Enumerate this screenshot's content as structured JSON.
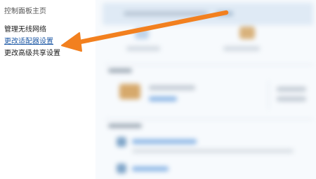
{
  "sidebar": {
    "home_label": "控制面板主页",
    "links": [
      {
        "label": "管理无线网络",
        "highlighted": false
      },
      {
        "label": "更改适配器设置",
        "highlighted": true
      },
      {
        "label": "更改高级共享设置",
        "highlighted": false
      }
    ]
  },
  "colors": {
    "link_highlight": "#1f5aa6",
    "arrow": "#f2801f"
  },
  "overlay": {
    "icon": "orange-arrow-annotation"
  }
}
